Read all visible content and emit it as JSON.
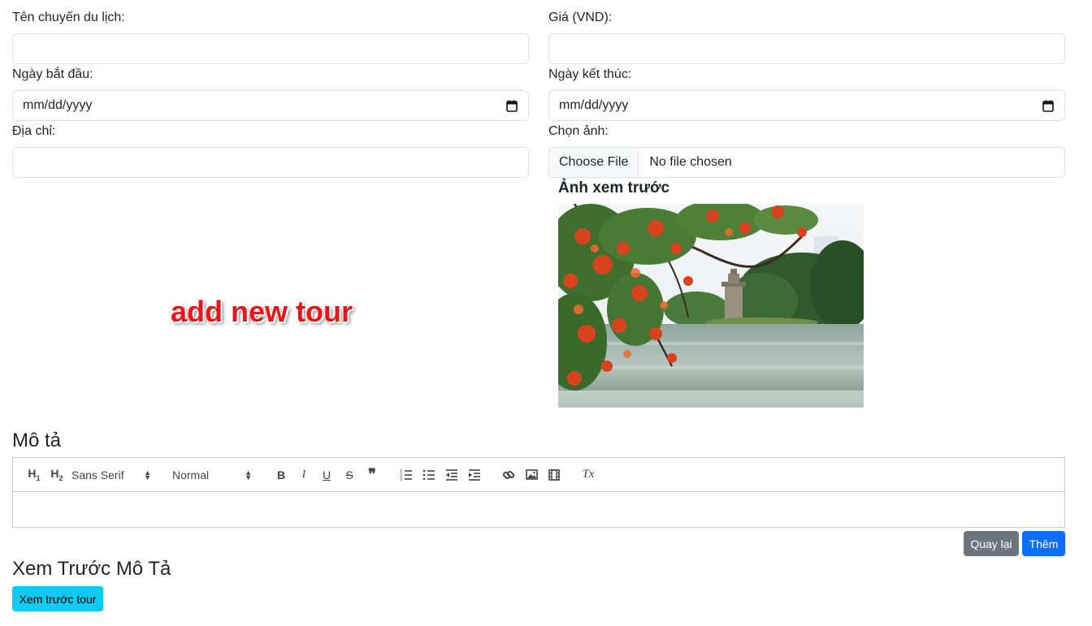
{
  "form": {
    "name_label": "Tên chuyến du lịch:",
    "name_value": "",
    "price_label": "Giá (VND):",
    "price_value": "",
    "start_label": "Ngày bắt đầu:",
    "start_value": "mm/dd/yyyy",
    "end_label": "Ngày kết thúc:",
    "end_value": "mm/dd/yyyy",
    "address_label": "Địa chỉ:",
    "address_value": "",
    "image_label": "Chọn ảnh:",
    "file_button": "Choose File",
    "file_status": "No file chosen"
  },
  "preview": {
    "title": "Ảnh xem trước",
    "image_icon": "lake-pagoda-photo"
  },
  "watermark": "add new tour",
  "description": {
    "title": "Mô tả",
    "toolbar": {
      "h1": "H1",
      "h2": "H2",
      "font": "Sans Serif",
      "size": "Normal",
      "bold": "B",
      "italic": "I",
      "underline": "U",
      "strike": "S",
      "quote": "❞",
      "clean": "Tx"
    },
    "content": ""
  },
  "actions": {
    "back_label": "Quay lại",
    "add_label": "Thêm"
  },
  "preview_desc": {
    "title": "Xem Trước Mô Tả",
    "button_label": "Xem trước tour"
  },
  "colors": {
    "secondary": "#6c757d",
    "primary": "#0d6efd",
    "info": "#0dcaf0",
    "watermark": "#e8151b"
  }
}
